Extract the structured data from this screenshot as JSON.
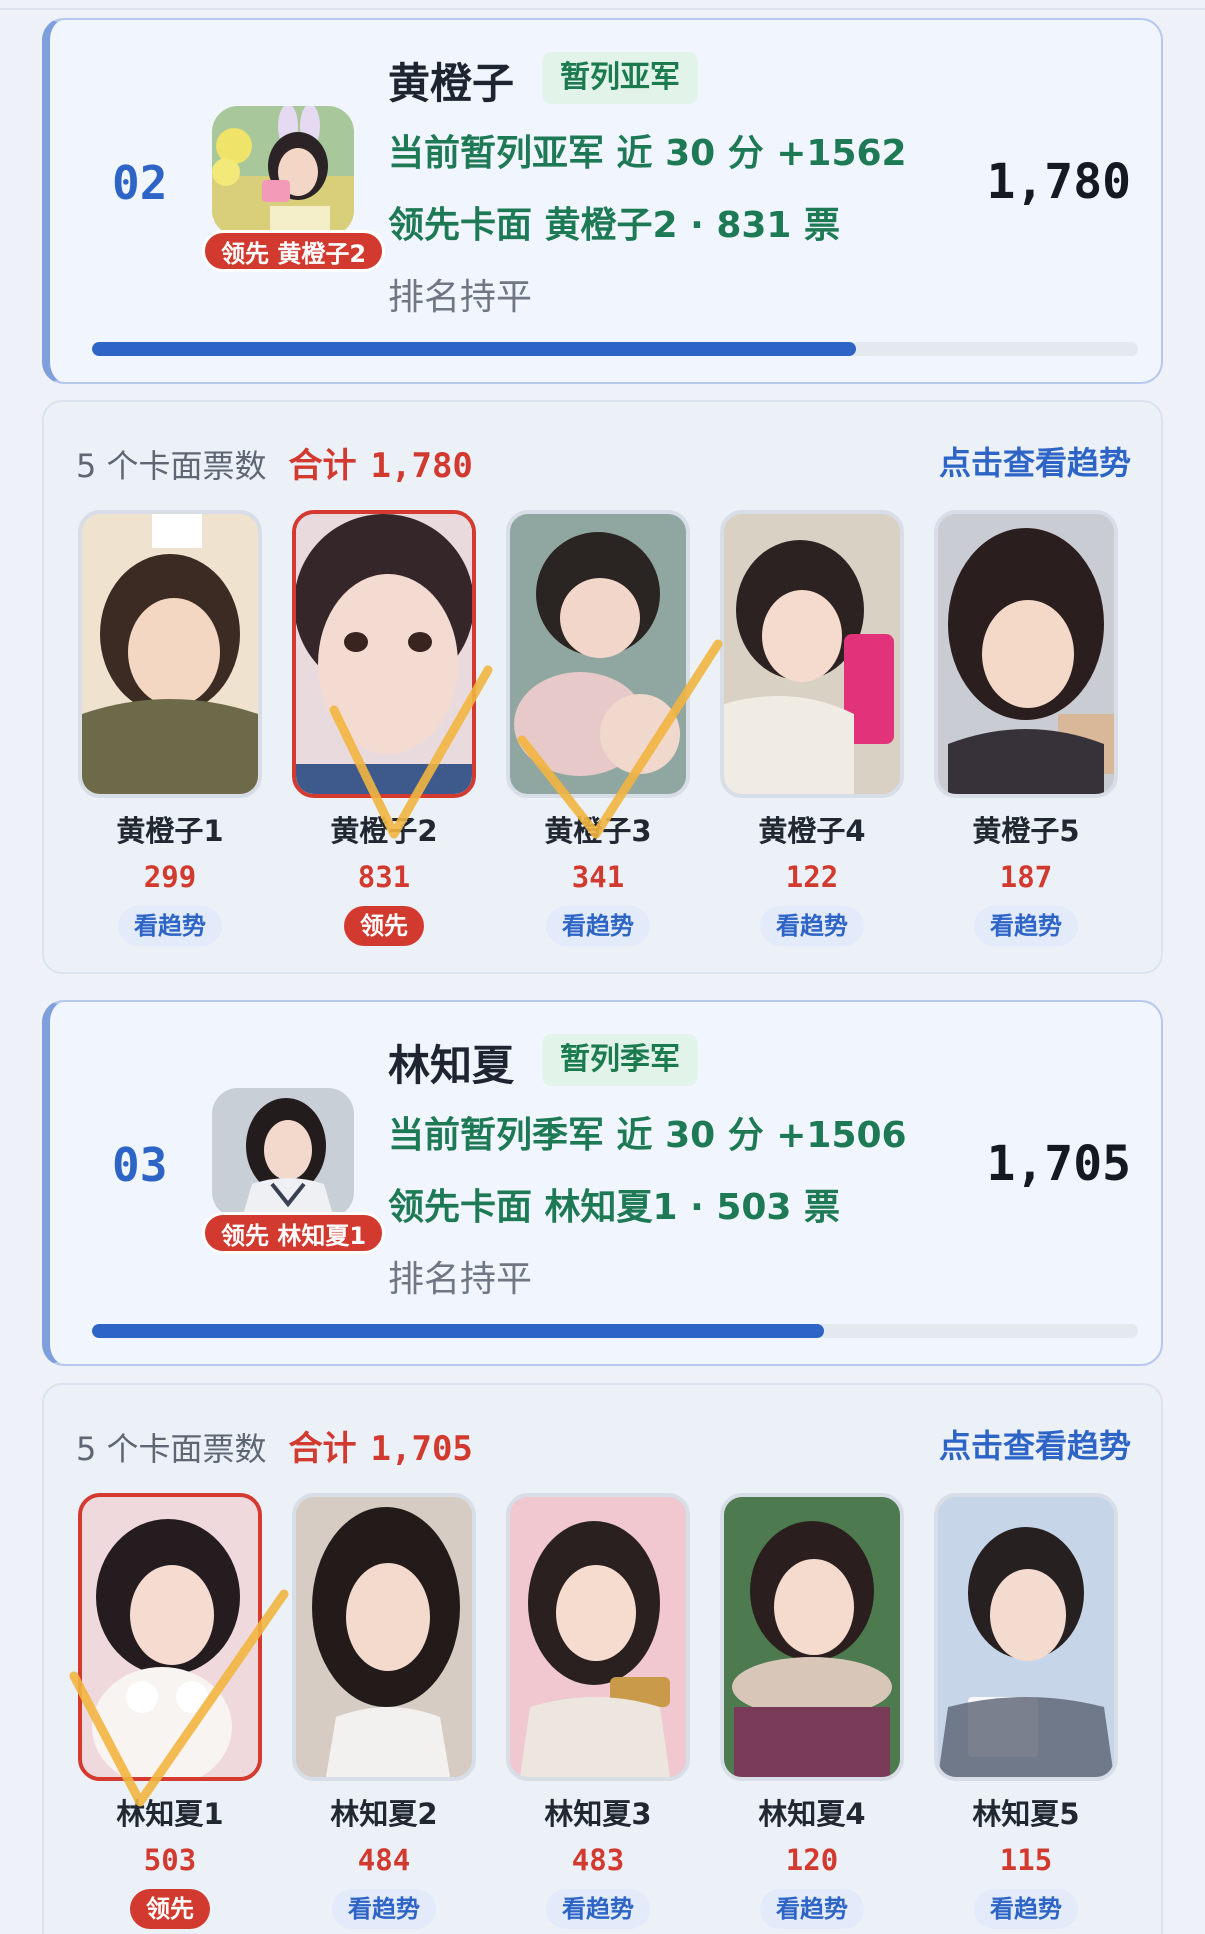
{
  "entries": [
    {
      "rank": "02",
      "name": "黄橙子",
      "place_badge": "暂列亚军",
      "status_line": "当前暂列亚军  近 30 分 +1562",
      "lead_card_line": "领先卡面 黄橙子2 · 831 票",
      "rank_change": "排名持平",
      "total": "1,780",
      "lead_badge": "领先 黄橙子2",
      "progress_percent": 73,
      "panel": {
        "count_label": "5 个卡面票数",
        "total_label": "合计",
        "total_value": "1,780",
        "trend_link": "点击查看趋势",
        "cards": [
          {
            "name": "黄橙子1",
            "votes": "299",
            "tag": "看趋势"
          },
          {
            "name": "黄橙子2",
            "votes": "831",
            "tag": "领先"
          },
          {
            "name": "黄橙子3",
            "votes": "341",
            "tag": "看趋势"
          },
          {
            "name": "黄橙子4",
            "votes": "122",
            "tag": "看趋势"
          },
          {
            "name": "黄橙子5",
            "votes": "187",
            "tag": "看趋势"
          }
        ]
      }
    },
    {
      "rank": "03",
      "name": "林知夏",
      "place_badge": "暂列季军",
      "status_line": "当前暂列季军  近 30 分 +1506",
      "lead_card_line": "领先卡面 林知夏1 · 503 票",
      "rank_change": "排名持平",
      "total": "1,705",
      "lead_badge": "领先 林知夏1",
      "progress_percent": 70,
      "panel": {
        "count_label": "5 个卡面票数",
        "total_label": "合计",
        "total_value": "1,705",
        "trend_link": "点击查看趋势",
        "cards": [
          {
            "name": "林知夏1",
            "votes": "503",
            "tag": "领先"
          },
          {
            "name": "林知夏2",
            "votes": "484",
            "tag": "看趋势"
          },
          {
            "name": "林知夏3",
            "votes": "483",
            "tag": "看趋势"
          },
          {
            "name": "林知夏4",
            "votes": "120",
            "tag": "看趋势"
          },
          {
            "name": "林知夏5",
            "votes": "115",
            "tag": "看趋势"
          }
        ]
      }
    }
  ],
  "colors": {
    "accent_blue": "#2d64c6",
    "lead_red": "#d23a2f",
    "status_green": "#1d7a55",
    "check_mark": "#f2b540"
  },
  "overlay_icons": [
    "checkmark-icon",
    "checkmark-icon",
    "checkmark-icon"
  ]
}
